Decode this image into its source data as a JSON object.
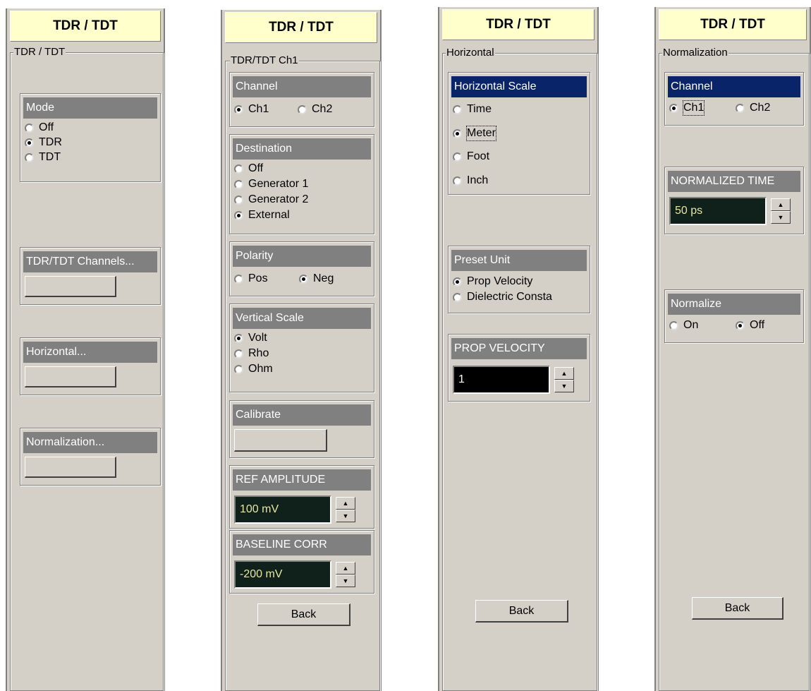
{
  "panel1": {
    "header": "TDR / TDT",
    "fieldset": "TDR / TDT",
    "mode": {
      "title": "Mode",
      "options": [
        "Off",
        "TDR",
        "TDT"
      ],
      "selected": "TDR"
    },
    "channels": {
      "title": "TDR/TDT Channels..."
    },
    "horizontal": {
      "title": "Horizontal..."
    },
    "normalization": {
      "title": "Normalization..."
    }
  },
  "panel2": {
    "header": "TDR / TDT",
    "fieldset": "TDR/TDT Ch1",
    "channel": {
      "title": "Channel",
      "options": [
        "Ch1",
        "Ch2"
      ],
      "selected": "Ch1"
    },
    "destination": {
      "title": "Destination",
      "options": [
        "Off",
        "Generator 1",
        "Generator 2",
        "External"
      ],
      "selected": "External"
    },
    "polarity": {
      "title": "Polarity",
      "options": [
        "Pos",
        "Neg"
      ],
      "selected": "Neg"
    },
    "vertical": {
      "title": "Vertical Scale",
      "options": [
        "Volt",
        "Rho",
        "Ohm"
      ],
      "selected": "Volt"
    },
    "calibrate": {
      "title": "Calibrate"
    },
    "ref_amplitude": {
      "title": "REF AMPLITUDE",
      "value": "100 mV"
    },
    "baseline": {
      "title": "BASELINE CORR",
      "value": "-200 mV"
    },
    "back": "Back"
  },
  "panel3": {
    "header": "TDR / TDT",
    "fieldset": "Horizontal",
    "hscale": {
      "title": "Horizontal Scale",
      "options": [
        "Time",
        "Meter",
        "Foot",
        "Inch"
      ],
      "selected": "Meter"
    },
    "preset": {
      "title": "Preset Unit",
      "options": [
        "Prop Velocity",
        "Dielectric Consta"
      ],
      "selected": "Prop Velocity"
    },
    "prop_velocity": {
      "title": "PROP VELOCITY",
      "value": "1"
    },
    "back": "Back"
  },
  "panel4": {
    "header": "TDR / TDT",
    "fieldset": "Normalization",
    "channel": {
      "title": "Channel",
      "options": [
        "Ch1",
        "Ch2"
      ],
      "selected": "Ch1"
    },
    "norm_time": {
      "title": "NORMALIZED TIME",
      "value": "50 ps"
    },
    "normalize": {
      "title": "Normalize",
      "options": [
        "On",
        "Off"
      ],
      "selected": "Off"
    },
    "back": "Back"
  },
  "icons": {
    "spin_up": "▲",
    "spin_down": "▼"
  }
}
